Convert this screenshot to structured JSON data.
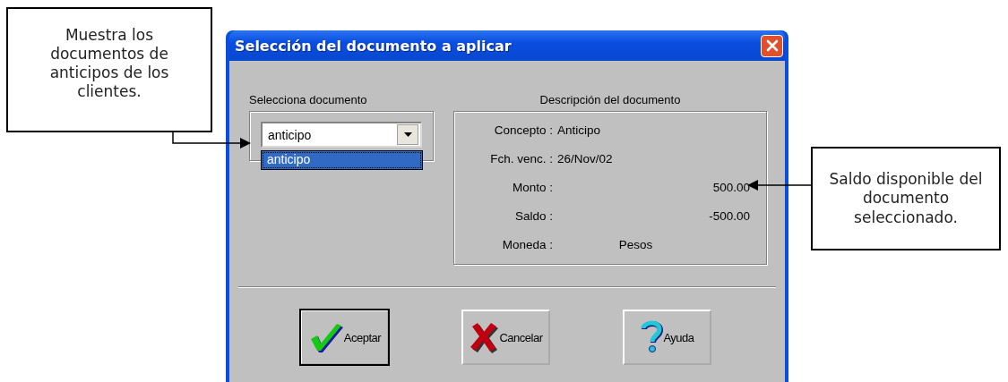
{
  "callouts": [
    {
      "text": "Muestra los documentos de anticipos de los clientes.",
      "kind": "left"
    },
    {
      "text": "Saldo disponible del documento seleccionado.",
      "kind": "right"
    }
  ],
  "window": {
    "title": "Selección del documento a aplicar"
  },
  "select_group": {
    "label": "Selecciona documento",
    "combo_value": "anticipo",
    "options": [
      {
        "label": "anticipo",
        "selected": true
      }
    ]
  },
  "description_group": {
    "label": "Descripción del documento",
    "rows": [
      {
        "label": "Concepto :",
        "value": "Anticipo",
        "kind": "text"
      },
      {
        "label": "Fch. venc. :",
        "value": "26/Nov/02",
        "kind": "text"
      },
      {
        "label": "Monto :",
        "value": "500.00",
        "kind": "amount"
      },
      {
        "label": "Saldo :",
        "value": "-500.00",
        "kind": "amount"
      },
      {
        "label": "Moneda :",
        "value": "Pesos",
        "kind": "center"
      }
    ]
  },
  "buttons": [
    {
      "label": "Aceptar",
      "kind": "check",
      "default": true
    },
    {
      "label": "Cancelar",
      "kind": "cross",
      "default": false
    },
    {
      "label": "Ayuda",
      "kind": "help",
      "default": false
    }
  ]
}
